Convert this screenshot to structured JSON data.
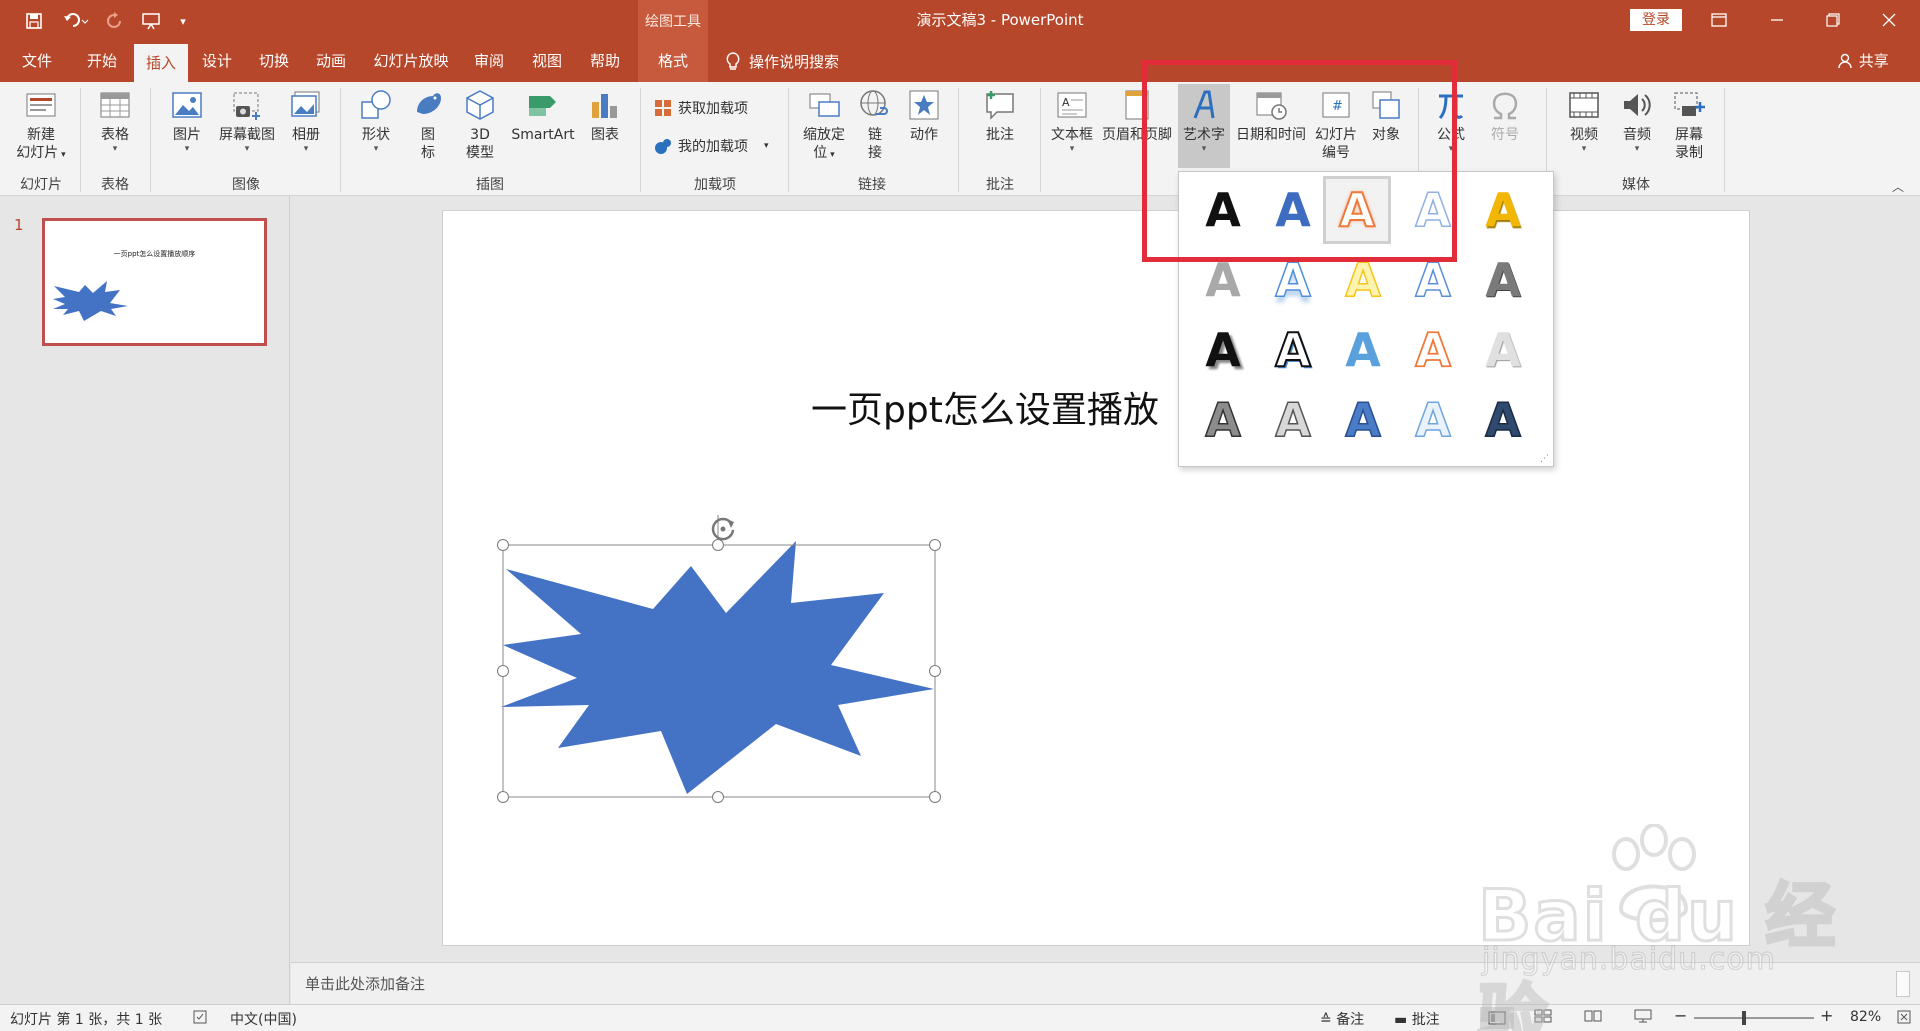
{
  "titlebar": {
    "context_group": "绘图工具",
    "document_title": "演示文稿3 - PowerPoint",
    "login": "登录"
  },
  "tabs": {
    "file": "文件",
    "home": "开始",
    "insert": "插入",
    "design": "设计",
    "transitions": "切换",
    "animations": "动画",
    "slideshow": "幻灯片放映",
    "review": "审阅",
    "view": "视图",
    "help": "帮助",
    "format": "格式",
    "tell_me": "操作说明搜索",
    "share": "共享"
  },
  "ribbon": {
    "new_slide_1": "新建",
    "new_slide_2": "幻灯片",
    "table": "表格",
    "picture": "图片",
    "screenshot": "屏幕截图",
    "album": "相册",
    "shapes": "形状",
    "icons_1": "图",
    "icons_2": "标",
    "model3d_1": "3D",
    "model3d_2": "模型",
    "smartart": "SmartArt",
    "chart": "图表",
    "get_addins": "获取加载项",
    "my_addins": "我的加载项",
    "zoom_1": "缩放定",
    "zoom_2": "位",
    "link_1": "链",
    "link_2": "接",
    "action": "动作",
    "comment": "批注",
    "textbox": "文本框",
    "header_footer": "页眉和页脚",
    "wordart": "艺术字",
    "datetime": "日期和时间",
    "slide_number_1": "幻灯片",
    "slide_number_2": "编号",
    "object": "对象",
    "equation": "公式",
    "symbol": "符号",
    "video": "视频",
    "audio": "音频",
    "screen_record_1": "屏幕",
    "screen_record_2": "录制",
    "groups": {
      "slides": "幻灯片",
      "tables": "表格",
      "images": "图像",
      "illustrations": "插图",
      "addins": "加载项",
      "links": "链接",
      "comments": "批注",
      "media": "媒体"
    }
  },
  "thumbnail": {
    "number": "1",
    "title": "一页ppt怎么设置播放顺序"
  },
  "slide": {
    "title": "一页ppt怎么设置播放",
    "shape_color": "#4472c4"
  },
  "wordart_gallery": {
    "letter": "A",
    "styles": [
      "black-fill",
      "blue-fill",
      "orange-outline-selected",
      "light-blue-outline",
      "gold-fill",
      "gray-gradient",
      "blue-reflection",
      "gold-reflection",
      "blue-outline",
      "gray-bevel",
      "black-shadow",
      "black-outline-white",
      "blue-gradient",
      "orange-outline",
      "silver-gradient",
      "gray-pattern",
      "gray-outline",
      "blue-bevel",
      "light-blue-glow",
      "dark-pattern"
    ]
  },
  "notes": {
    "placeholder": "单击此处添加备注"
  },
  "statusbar": {
    "slide_info": "幻灯片 第 1 张，共 1 张",
    "language": "中文(中国)",
    "notes": "备注",
    "comments": "批注",
    "zoom_minus": "−",
    "zoom_plus": "+",
    "zoom": "82%"
  },
  "watermark": {
    "brand": "Bai du 经验",
    "url": "jingyan.baidu.com"
  },
  "colors": {
    "accent": "#b7472a",
    "highlight": "#e32c3a",
    "selection_border": "#c0504d"
  }
}
